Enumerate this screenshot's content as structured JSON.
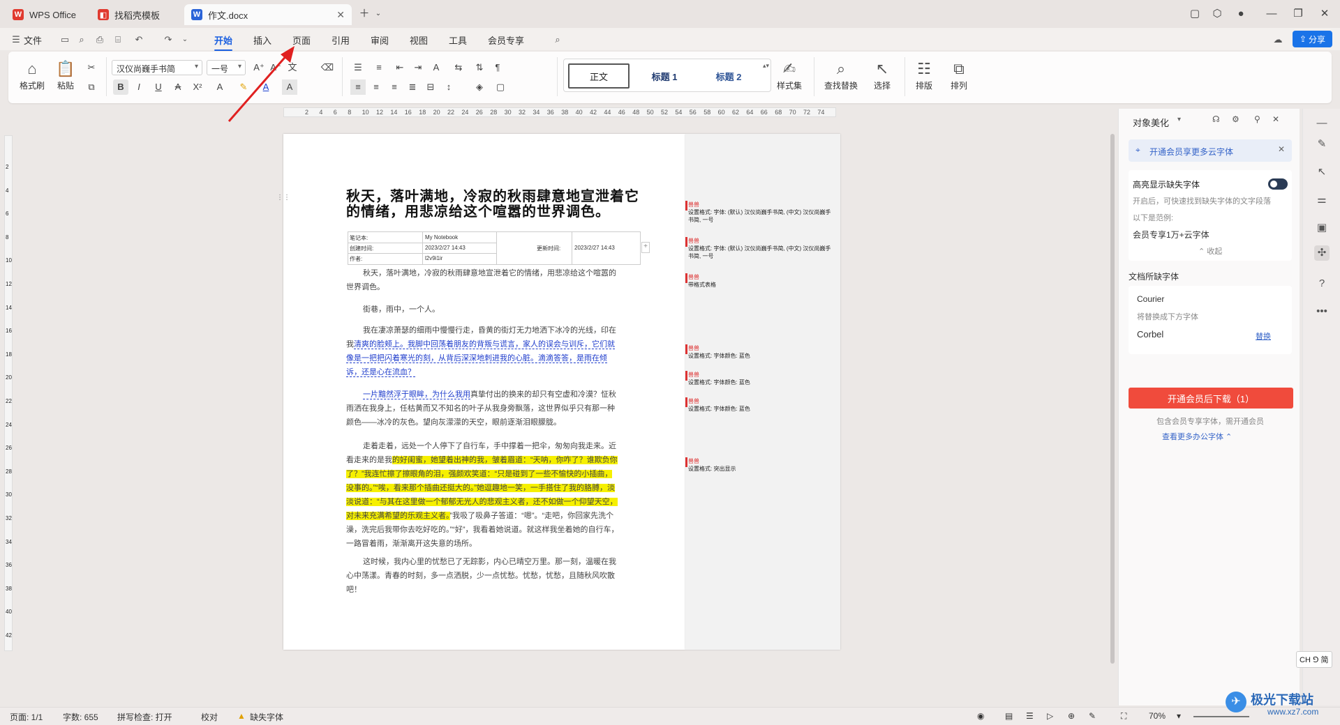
{
  "tabs": [
    {
      "label": "WPS Office",
      "icon": "wps-logo-icon",
      "color": "#e03a2f"
    },
    {
      "label": "找稻壳模板",
      "icon": "docer-icon",
      "color": "#e03a2f"
    },
    {
      "label": "作文.docx",
      "icon": "word-doc-icon",
      "color": "#2b64d8"
    }
  ],
  "menu": {
    "file": "文件",
    "items": [
      "开始",
      "插入",
      "页面",
      "引用",
      "审阅",
      "视图",
      "工具",
      "会员专享"
    ],
    "share": "分享"
  },
  "ribbon": {
    "format_brush": "格式刷",
    "paste": "粘贴",
    "font_name": "汉仪尚巍手书简",
    "font_size": "一号",
    "styles": [
      "正文",
      "标题 1",
      "标题 2"
    ],
    "style_set": "样式集",
    "find_replace": "查找替换",
    "select": "选择",
    "layout": "排版",
    "arrange": "排列"
  },
  "ruler_ticks": [
    "2",
    "4",
    "6",
    "8",
    "10",
    "12",
    "14",
    "16",
    "18",
    "20",
    "22",
    "24",
    "26",
    "28",
    "30",
    "32",
    "34",
    "36",
    "38",
    "40",
    "42",
    "44",
    "46",
    "48",
    "50",
    "52",
    "54",
    "56",
    "58",
    "60",
    "62",
    "64",
    "66",
    "68",
    "70",
    "72",
    "74"
  ],
  "vruler_ticks": [
    "2",
    "4",
    "6",
    "8",
    "10",
    "12",
    "14",
    "16",
    "18",
    "20",
    "22",
    "24",
    "26",
    "28",
    "30",
    "32",
    "34",
    "36",
    "38",
    "40",
    "42"
  ],
  "document": {
    "title": "秋天，落叶满地，冷寂的秋雨肆意地宣泄着它的情绪，用悲凉给这个喧嚣的世界调色。",
    "note_table": {
      "notebook_label": "笔记本:",
      "notebook_value": "My Notebook",
      "created_label": "创建时间:",
      "created_value": "2023/2/27 14:43",
      "updated_label": "更新时间:",
      "updated_value": "2023/2/27 14:43",
      "author_label": "作者:",
      "author_value": "l2v9i1ir"
    },
    "p1": "秋天，落叶满地，冷寂的秋雨肆意地宣泄着它的情绪，用悲凉给这个喧嚣的世界调色。",
    "p2": "街巷，雨中，一个人。",
    "p3a": "我在凄凉萧瑟的细雨中慢慢行走，昏黄的街灯无力地洒下冰冷的光线，印在我",
    "p3b": "清爽的脸颊上。我脚中回荡着朋友的背叛与谎言，家人的误会与训斥，它们就像是一把把闪着寒光的刻，从背后深深地刺进我的心脏。滴滴答答，是雨在倾诉，还是心在流血？",
    "p4a": "一片黯然浮于眼眸，为什么我用",
    "p4b": "真挚付出的换来的却只有空虚和冷漠？怔秋雨洒在我身上，任枯黄而又不知名的叶子从我身旁飘落，这世界似乎只有那一种颜色——冰冷的灰色。望向灰濛濛的天空，眼前逐渐泪眼朦胧。",
    "p5a": "走着走着，远处一个人停下了自行车，手中撑着一把伞，匆匆向我走来。近看走来的是我",
    "p5b": "的好闺蜜，她望着出神的我，皱着眉道：“天呐，你咋了？谁欺负你了？”我连忙擦了擦眼角的泪，强颜欢笑道：“只是碰到了一些不愉快的小插曲，没事的。”“唉，看来那个插曲还挺大的。”她逗趣地一笑，一手搭住了我的胳膊，淡淡说道：“与其在这里做一个郁郁无光人的悲观主义者，还不如做一个仰望天空，对未来充满希望的乐观主义者。",
    "p5c": "”我吸了吸鼻子答道：“嗯”。“走吧，你回家先洗个澡，洗完后我带你去吃好吃的。”“好”，我看着她说道。就这样我坐着她的自行车，一路冒着雨，渐渐离开这失意的场所。",
    "p6": "这时候，我内心里的忧愁已了无踪影，内心已晴空万里。那一刻，温暖在我心中荡漾。青春的时刻，多一点洒脱，少一点忧愁。忧愁，忧愁，且随秋风吹散吧！"
  },
  "comments": [
    {
      "tag": "兽兽",
      "text": "设置格式: 字体: (默认) 汉仪尚巍手书简, (中文) 汉仪尚巍手书简, 一号"
    },
    {
      "tag": "兽兽",
      "text": "设置格式: 字体: (默认) 汉仪尚巍手书简, (中文) 汉仪尚巍手书简, 一号"
    },
    {
      "tag": "兽兽",
      "text": "带格式表格"
    },
    {
      "tag": "兽兽",
      "text": "设置格式: 字体颜色: 蓝色"
    },
    {
      "tag": "兽兽",
      "text": "设置格式: 字体颜色: 蓝色"
    },
    {
      "tag": "兽兽",
      "text": "设置格式: 字体颜色: 蓝色"
    },
    {
      "tag": "兽兽",
      "text": "设置格式: 突出显示"
    }
  ],
  "panel": {
    "title": "对象美化",
    "promo": "开通会员享更多云字体",
    "highlight_missing": "高亮显示缺失字体",
    "highlight_desc": "开启后，可快速找到缺失字体的文字段落",
    "example_label": "以下是范例:",
    "vip_fonts": "会员专享1万+云字体",
    "collapse": "收起",
    "missing_section": "文档所缺字体",
    "missing_font": "Courier",
    "replace_hint": "将替换成下方字体",
    "replacement_font": "Corbel",
    "replace_link": "替换",
    "vip_download": "开通会员后下载（1）",
    "vip_note": "包含会员专享字体，需开通会员",
    "more_fonts": "查看更多办公字体"
  },
  "ime": "CH ⅁ 简",
  "status": {
    "page": "页面: 1/1",
    "words": "字数: 655",
    "spell": "拼写检查: 打开",
    "proof": "校对",
    "missing_font": "缺失字体",
    "zoom": "70%"
  },
  "watermark": "极光下载站",
  "watermark_url": "www.xz7.com",
  "colors": {
    "accent": "#1a5fe0",
    "vip": "#f04b3c",
    "highlight": "#f6f000",
    "arrow": "#e02020"
  }
}
